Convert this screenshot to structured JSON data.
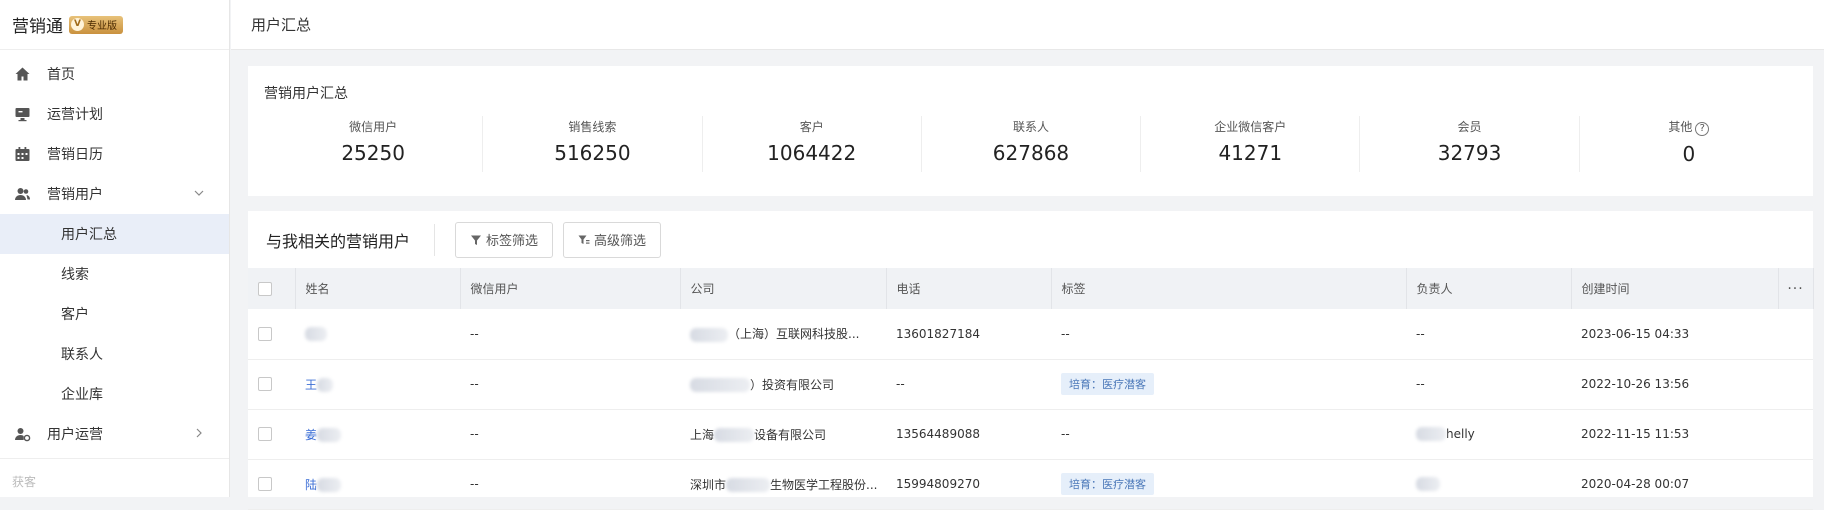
{
  "app": {
    "name": "营销通",
    "badge_letter": "V",
    "edition": "专业版"
  },
  "sidebar": {
    "items": [
      {
        "label": "首页",
        "icon": "home-icon"
      },
      {
        "label": "运营计划",
        "icon": "monitor-icon"
      },
      {
        "label": "营销日历",
        "icon": "calendar-icon"
      },
      {
        "label": "营销用户",
        "icon": "users-icon",
        "expanded": true
      }
    ],
    "sub_items": [
      {
        "label": "用户汇总",
        "active": true
      },
      {
        "label": "线索"
      },
      {
        "label": "客户"
      },
      {
        "label": "联系人"
      },
      {
        "label": "企业库"
      }
    ],
    "ops_item": {
      "label": "用户运营",
      "icon": "user-gear-icon"
    },
    "footer": "获客"
  },
  "page": {
    "title": "用户汇总"
  },
  "summary": {
    "title": "营销用户汇总",
    "stats": [
      {
        "label": "微信用户",
        "value": "25250"
      },
      {
        "label": "销售线索",
        "value": "516250"
      },
      {
        "label": "客户",
        "value": "1064422"
      },
      {
        "label": "联系人",
        "value": "627868"
      },
      {
        "label": "企业微信客户",
        "value": "41271"
      },
      {
        "label": "会员",
        "value": "32793"
      },
      {
        "label": "其他",
        "value": "0",
        "help": "?"
      }
    ]
  },
  "table": {
    "title": "与我相关的营销用户",
    "tag_filter": "标签筛选",
    "advanced_filter": "高级筛选",
    "columns": [
      "姓名",
      "微信用户",
      "公司",
      "电话",
      "标签",
      "负责人",
      "创建时间",
      "···"
    ],
    "rows": [
      {
        "name": "",
        "wechat": "--",
        "company": "（上海）互联网科技股...",
        "phone": "13601827184",
        "tag": "--",
        "owner": "--",
        "created": "2023-06-15 04:33"
      },
      {
        "name": "王",
        "wechat": "--",
        "company": "）投资有限公司",
        "phone": "--",
        "tag": "培育：医疗潜客",
        "owner": "--",
        "created": "2022-10-26 13:56"
      },
      {
        "name": "姜",
        "wechat": "--",
        "company": "上海",
        "company2": "设备有限公司",
        "phone": "13564489088",
        "tag": "--",
        "owner": "helly",
        "created": "2022-11-15 11:53"
      },
      {
        "name": "陆",
        "wechat": "--",
        "company": "深圳市",
        "company2": "生物医学工程股份...",
        "phone": "15994809270",
        "tag": "培育：医疗潜客",
        "owner": "",
        "created": "2020-04-28 00:07"
      }
    ]
  },
  "colors": {
    "accent": "#3d6fd6",
    "tag_bg": "#e6effa",
    "active_bg": "#e9eef8"
  }
}
